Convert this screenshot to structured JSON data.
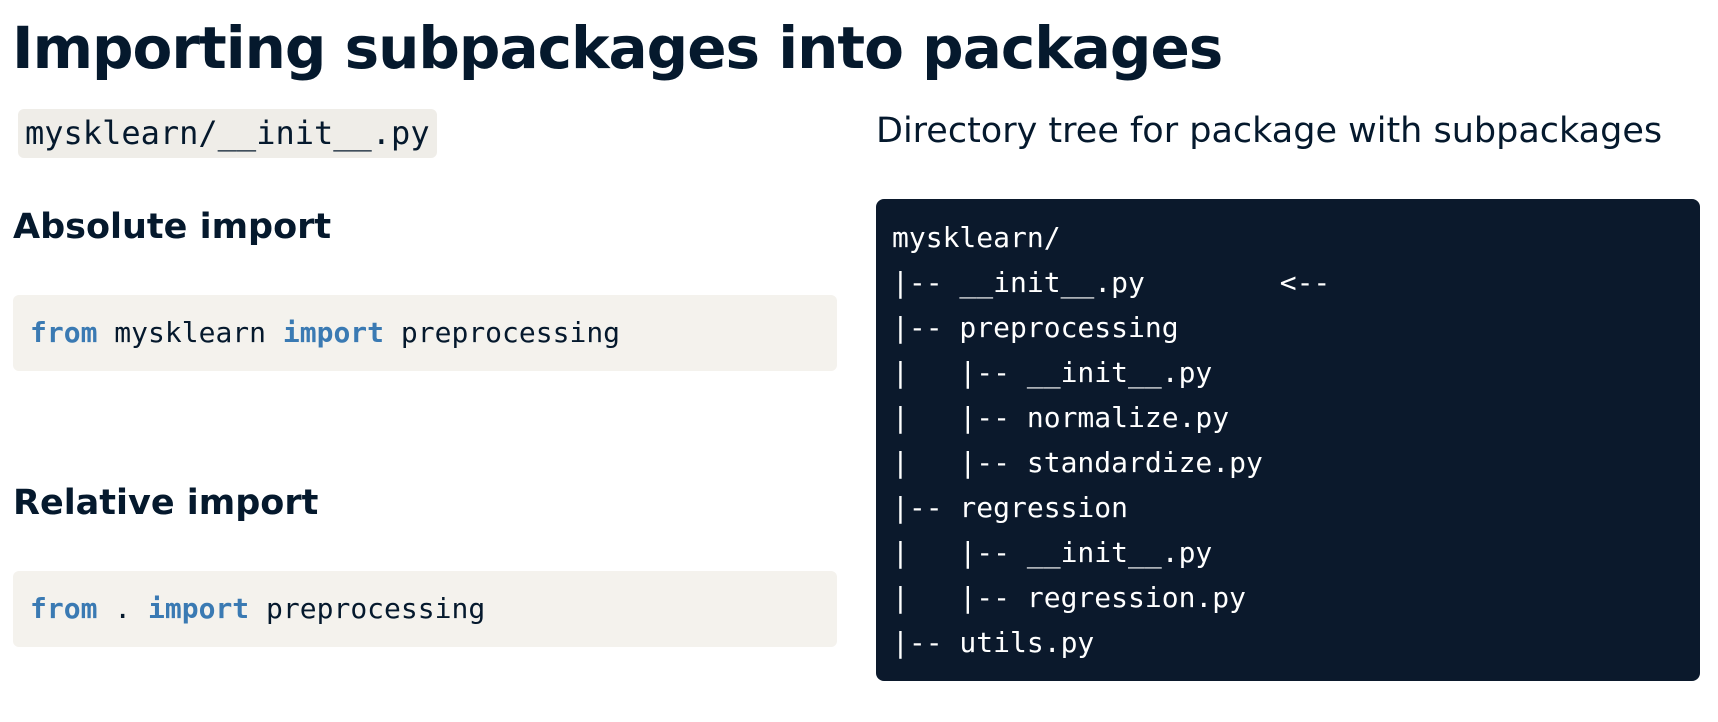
{
  "title": "Importing subpackages into packages",
  "file_label": "mysklearn/__init__.py",
  "absolute": {
    "heading": "Absolute import",
    "code": {
      "kw1": "from",
      "mid": " mysklearn ",
      "kw2": "import",
      "rest": " preprocessing"
    }
  },
  "relative": {
    "heading": "Relative import",
    "code": {
      "kw1": "from",
      "mid": " . ",
      "kw2": "import",
      "rest": " preprocessing"
    }
  },
  "tree": {
    "caption": "Directory tree for package with subpackages",
    "lines": [
      "mysklearn/",
      "|-- __init__.py        <--",
      "|-- preprocessing",
      "|   |-- __init__.py",
      "|   |-- normalize.py",
      "|   |-- standardize.py",
      "|-- regression",
      "|   |-- __init__.py",
      "|   |-- regression.py",
      "|-- utils.py"
    ]
  },
  "colors": {
    "heading_text": "#05192d",
    "keyword": "#3a7ab3",
    "code_background": "#f4f2ed",
    "file_chip_background": "#efede8",
    "tree_background": "#0b192c",
    "tree_text": "#ffffff"
  }
}
